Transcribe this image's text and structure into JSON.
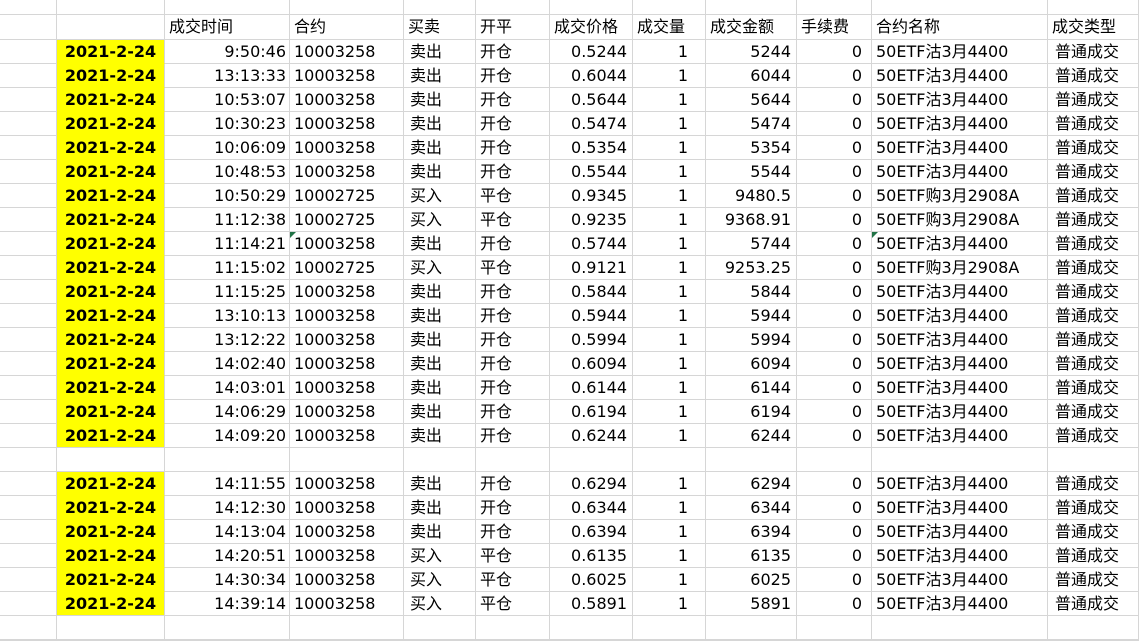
{
  "colors": {
    "highlight": "#ffff00",
    "gridline": "#d6d6d6",
    "error_marker": "#217346",
    "text": "#000000",
    "background": "#ffffff"
  },
  "sheet": {
    "headers": [
      "成交时间",
      "合约",
      "买卖",
      "开平",
      "成交价格",
      "成交量",
      "成交金额",
      "手续费",
      "合约名称",
      "成交类型"
    ],
    "rows": [
      {
        "date": "2021-2-24",
        "time": "9:50:46",
        "contract": "10003258",
        "side": "卖出",
        "openclose": "开仓",
        "price": "0.5244",
        "qty": "1",
        "amount": "5244",
        "fee": "0",
        "name": "50ETF沽3月4400",
        "type": "普通成交"
      },
      {
        "date": "2021-2-24",
        "time": "13:13:33",
        "contract": "10003258",
        "side": "卖出",
        "openclose": "开仓",
        "price": "0.6044",
        "qty": "1",
        "amount": "6044",
        "fee": "0",
        "name": "50ETF沽3月4400",
        "type": "普通成交"
      },
      {
        "date": "2021-2-24",
        "time": "10:53:07",
        "contract": "10003258",
        "side": "卖出",
        "openclose": "开仓",
        "price": "0.5644",
        "qty": "1",
        "amount": "5644",
        "fee": "0",
        "name": "50ETF沽3月4400",
        "type": "普通成交"
      },
      {
        "date": "2021-2-24",
        "time": "10:30:23",
        "contract": "10003258",
        "side": "卖出",
        "openclose": "开仓",
        "price": "0.5474",
        "qty": "1",
        "amount": "5474",
        "fee": "0",
        "name": "50ETF沽3月4400",
        "type": "普通成交"
      },
      {
        "date": "2021-2-24",
        "time": "10:06:09",
        "contract": "10003258",
        "side": "卖出",
        "openclose": "开仓",
        "price": "0.5354",
        "qty": "1",
        "amount": "5354",
        "fee": "0",
        "name": "50ETF沽3月4400",
        "type": "普通成交"
      },
      {
        "date": "2021-2-24",
        "time": "10:48:53",
        "contract": "10003258",
        "side": "卖出",
        "openclose": "开仓",
        "price": "0.5544",
        "qty": "1",
        "amount": "5544",
        "fee": "0",
        "name": "50ETF沽3月4400",
        "type": "普通成交"
      },
      {
        "date": "2021-2-24",
        "time": "10:50:29",
        "contract": "10002725",
        "side": "买入",
        "openclose": "平仓",
        "price": "0.9345",
        "qty": "1",
        "amount": "9480.5",
        "fee": "0",
        "name": "50ETF购3月2908A",
        "type": "普通成交"
      },
      {
        "date": "2021-2-24",
        "time": "11:12:38",
        "contract": "10002725",
        "side": "买入",
        "openclose": "平仓",
        "price": "0.9235",
        "qty": "1",
        "amount": "9368.91",
        "fee": "0",
        "name": "50ETF购3月2908A",
        "type": "普通成交"
      },
      {
        "date": "2021-2-24",
        "time": "11:14:21",
        "contract": "10003258",
        "side": "卖出",
        "openclose": "开仓",
        "price": "0.5744",
        "qty": "1",
        "amount": "5744",
        "fee": "0",
        "name": "50ETF沽3月4400",
        "type": "普通成交",
        "markers": {
          "contract": true,
          "name": true
        }
      },
      {
        "date": "2021-2-24",
        "time": "11:15:02",
        "contract": "10002725",
        "side": "买入",
        "openclose": "平仓",
        "price": "0.9121",
        "qty": "1",
        "amount": "9253.25",
        "fee": "0",
        "name": "50ETF购3月2908A",
        "type": "普通成交"
      },
      {
        "date": "2021-2-24",
        "time": "11:15:25",
        "contract": "10003258",
        "side": "卖出",
        "openclose": "开仓",
        "price": "0.5844",
        "qty": "1",
        "amount": "5844",
        "fee": "0",
        "name": "50ETF沽3月4400",
        "type": "普通成交"
      },
      {
        "date": "2021-2-24",
        "time": "13:10:13",
        "contract": "10003258",
        "side": "卖出",
        "openclose": "开仓",
        "price": "0.5944",
        "qty": "1",
        "amount": "5944",
        "fee": "0",
        "name": "50ETF沽3月4400",
        "type": "普通成交"
      },
      {
        "date": "2021-2-24",
        "time": "13:12:22",
        "contract": "10003258",
        "side": "卖出",
        "openclose": "开仓",
        "price": "0.5994",
        "qty": "1",
        "amount": "5994",
        "fee": "0",
        "name": "50ETF沽3月4400",
        "type": "普通成交"
      },
      {
        "date": "2021-2-24",
        "time": "14:02:40",
        "contract": "10003258",
        "side": "卖出",
        "openclose": "开仓",
        "price": "0.6094",
        "qty": "1",
        "amount": "6094",
        "fee": "0",
        "name": "50ETF沽3月4400",
        "type": "普通成交"
      },
      {
        "date": "2021-2-24",
        "time": "14:03:01",
        "contract": "10003258",
        "side": "卖出",
        "openclose": "开仓",
        "price": "0.6144",
        "qty": "1",
        "amount": "6144",
        "fee": "0",
        "name": "50ETF沽3月4400",
        "type": "普通成交"
      },
      {
        "date": "2021-2-24",
        "time": "14:06:29",
        "contract": "10003258",
        "side": "卖出",
        "openclose": "开仓",
        "price": "0.6194",
        "qty": "1",
        "amount": "6194",
        "fee": "0",
        "name": "50ETF沽3月4400",
        "type": "普通成交"
      },
      {
        "date": "2021-2-24",
        "time": "14:09:20",
        "contract": "10003258",
        "side": "卖出",
        "openclose": "开仓",
        "price": "0.6244",
        "qty": "1",
        "amount": "6244",
        "fee": "0",
        "name": "50ETF沽3月4400",
        "type": "普通成交"
      },
      {
        "blank": true
      },
      {
        "date": "2021-2-24",
        "time": "14:11:55",
        "contract": "10003258",
        "side": "卖出",
        "openclose": "开仓",
        "price": "0.6294",
        "qty": "1",
        "amount": "6294",
        "fee": "0",
        "name": "50ETF沽3月4400",
        "type": "普通成交"
      },
      {
        "date": "2021-2-24",
        "time": "14:12:30",
        "contract": "10003258",
        "side": "卖出",
        "openclose": "开仓",
        "price": "0.6344",
        "qty": "1",
        "amount": "6344",
        "fee": "0",
        "name": "50ETF沽3月4400",
        "type": "普通成交"
      },
      {
        "date": "2021-2-24",
        "time": "14:13:04",
        "contract": "10003258",
        "side": "卖出",
        "openclose": "开仓",
        "price": "0.6394",
        "qty": "1",
        "amount": "6394",
        "fee": "0",
        "name": "50ETF沽3月4400",
        "type": "普通成交"
      },
      {
        "date": "2021-2-24",
        "time": "14:20:51",
        "contract": "10003258",
        "side": "买入",
        "openclose": "平仓",
        "price": "0.6135",
        "qty": "1",
        "amount": "6135",
        "fee": "0",
        "name": "50ETF沽3月4400",
        "type": "普通成交"
      },
      {
        "date": "2021-2-24",
        "time": "14:30:34",
        "contract": "10003258",
        "side": "买入",
        "openclose": "平仓",
        "price": "0.6025",
        "qty": "1",
        "amount": "6025",
        "fee": "0",
        "name": "50ETF沽3月4400",
        "type": "普通成交"
      },
      {
        "date": "2021-2-24",
        "time": "14:39:14",
        "contract": "10003258",
        "side": "买入",
        "openclose": "平仓",
        "price": "0.5891",
        "qty": "1",
        "amount": "5891",
        "fee": "0",
        "name": "50ETF沽3月4400",
        "type": "普通成交"
      },
      {
        "blank": true
      }
    ]
  }
}
